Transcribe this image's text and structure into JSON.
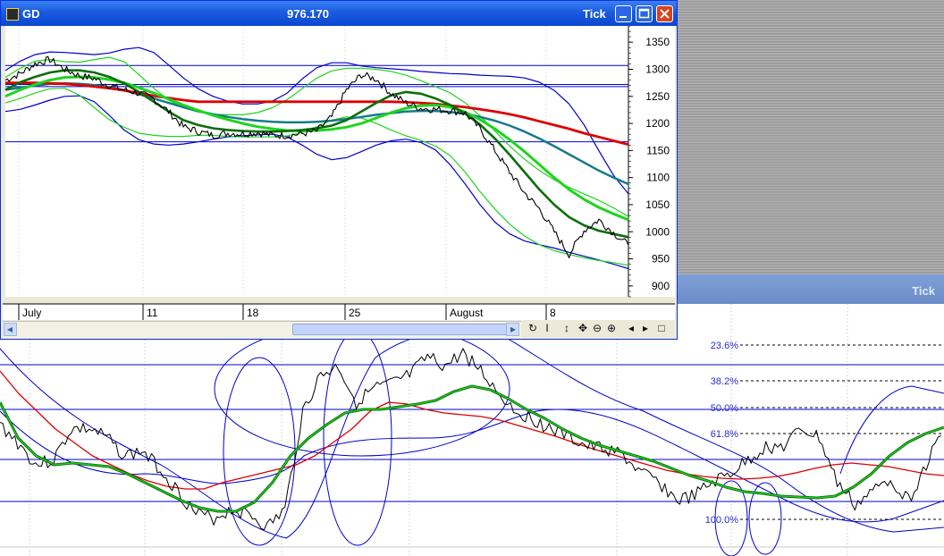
{
  "window": {
    "title": "GD",
    "value": "976.170",
    "mode": "Tick",
    "minimize_icon": "minimize-icon",
    "maximize_icon": "maximize-icon",
    "close_icon": "close-icon"
  },
  "background_window": {
    "mode": "Tick"
  },
  "toolbar": {
    "scroll_left": "◂",
    "scroll_right": "▸",
    "refresh": "↻",
    "cursor": "I",
    "arrange": "↕",
    "pan": "✥",
    "zoom_out": "⊖",
    "zoom_in": "⊕",
    "prev": "◂",
    "next": "▸",
    "restore": "□"
  },
  "colors": {
    "price": "#000000",
    "envelope_blue": "#0000cc",
    "ma_red": "#dd0000",
    "ma_dark_green": "#0a6e0a",
    "ma_green": "#1fd41f",
    "band_light_green": "#1fd41f",
    "ma_teal": "#177a8a",
    "level_line": "#0000cc"
  },
  "chart_data": [
    {
      "type": "line",
      "y_ticks": [
        900,
        950,
        1000,
        1050,
        1100,
        1150,
        1200,
        1250,
        1300,
        1350
      ],
      "ylim": [
        880,
        1380
      ],
      "x_tick_labels": [
        "July",
        "11",
        "18",
        "25",
        "August",
        "8"
      ],
      "horizontal_levels": [
        1307,
        1272,
        1268,
        1166
      ],
      "series": [
        {
          "key": "price",
          "values": [
            1280,
            1292,
            1310,
            1318,
            1300,
            1288,
            1283,
            1270,
            1262,
            1256,
            1245,
            1222,
            1194,
            1185,
            1178,
            1182,
            1181,
            1183,
            1178,
            1178,
            1181,
            1186,
            1212,
            1262,
            1290,
            1282,
            1255,
            1238,
            1228,
            1226,
            1224,
            1219,
            1190,
            1150,
            1110,
            1072,
            1042,
            1000,
            958,
            1002,
            1022,
            998,
            975
          ]
        },
        {
          "key": "ma_red",
          "values": [
            1275,
            1275,
            1275,
            1274,
            1273,
            1271,
            1268,
            1265,
            1261,
            1256,
            1251,
            1247,
            1243,
            1240,
            1240,
            1240,
            1240,
            1240,
            1240,
            1240,
            1240,
            1240,
            1240,
            1240,
            1240,
            1240,
            1240,
            1239,
            1238,
            1236,
            1233,
            1230,
            1226,
            1222,
            1217,
            1211,
            1204,
            1197,
            1190,
            1182,
            1175,
            1168,
            1161
          ]
        },
        {
          "key": "ma_dark_green",
          "values": [
            1262,
            1276,
            1286,
            1294,
            1298,
            1298,
            1294,
            1286,
            1274,
            1258,
            1240,
            1222,
            1206,
            1197,
            1191,
            1188,
            1186,
            1185,
            1185,
            1186,
            1188,
            1191,
            1196,
            1206,
            1222,
            1238,
            1252,
            1258,
            1255,
            1246,
            1234,
            1218,
            1198,
            1172,
            1142,
            1110,
            1078,
            1050,
            1027,
            1012,
            1002,
            996,
            990
          ]
        },
        {
          "key": "ma_green",
          "values": [
            1250,
            1262,
            1272,
            1280,
            1285,
            1286,
            1285,
            1281,
            1275,
            1266,
            1256,
            1245,
            1234,
            1224,
            1215,
            1207,
            1200,
            1194,
            1190,
            1187,
            1186,
            1187,
            1189,
            1193,
            1200,
            1210,
            1220,
            1228,
            1233,
            1234,
            1230,
            1221,
            1207,
            1190,
            1170,
            1148,
            1124,
            1100,
            1078,
            1060,
            1045,
            1033,
            1022
          ]
        },
        {
          "key": "ma_teal",
          "values": [
            1262,
            1266,
            1270,
            1273,
            1274,
            1273,
            1271,
            1267,
            1261,
            1254,
            1246,
            1238,
            1230,
            1223,
            1217,
            1212,
            1208,
            1205,
            1203,
            1202,
            1202,
            1203,
            1205,
            1208,
            1212,
            1216,
            1219,
            1222,
            1223,
            1223,
            1221,
            1218,
            1212,
            1205,
            1196,
            1185,
            1172,
            1158,
            1143,
            1128,
            1113,
            1100,
            1088
          ]
        },
        {
          "key": "env_upper",
          "values": [
            1298,
            1315,
            1327,
            1332,
            1331,
            1329,
            1327,
            1330,
            1337,
            1340,
            1331,
            1308,
            1284,
            1264,
            1250,
            1241,
            1236,
            1236,
            1241,
            1256,
            1282,
            1303,
            1312,
            1312,
            1306,
            1303,
            1301,
            1299,
            1296,
            1294,
            1292,
            1291,
            1289,
            1288,
            1287,
            1284,
            1276,
            1261,
            1236,
            1198,
            1150,
            1104,
            1070
          ]
        },
        {
          "key": "env_lower",
          "values": [
            1222,
            1226,
            1234,
            1243,
            1250,
            1251,
            1240,
            1215,
            1188,
            1170,
            1162,
            1160,
            1162,
            1166,
            1171,
            1175,
            1177,
            1179,
            1180,
            1175,
            1160,
            1143,
            1133,
            1137,
            1148,
            1160,
            1168,
            1171,
            1165,
            1151,
            1123,
            1088,
            1050,
            1018,
            996,
            983,
            976,
            970,
            962,
            955,
            948,
            940,
            932
          ]
        },
        {
          "key": "band_upper",
          "values": [
            1285,
            1302,
            1315,
            1318,
            1314,
            1313,
            1318,
            1322,
            1314,
            1290,
            1265,
            1243,
            1229,
            1221,
            1217,
            1216,
            1216,
            1220,
            1229,
            1244,
            1264,
            1284,
            1297,
            1302,
            1302,
            1300,
            1296,
            1289,
            1279,
            1268,
            1256,
            1238,
            1214,
            1186,
            1158,
            1134,
            1113,
            1096,
            1082,
            1070,
            1058,
            1044,
            1028
          ]
        },
        {
          "key": "band_lower",
          "values": [
            1238,
            1246,
            1256,
            1264,
            1265,
            1252,
            1229,
            1207,
            1193,
            1182,
            1178,
            1176,
            1176,
            1178,
            1178,
            1176,
            1175,
            1175,
            1175,
            1177,
            1183,
            1194,
            1206,
            1212,
            1210,
            1200,
            1188,
            1177,
            1169,
            1158,
            1140,
            1110,
            1074,
            1042,
            1014,
            992,
            976,
            965,
            958,
            952,
            947,
            943,
            938
          ]
        }
      ]
    },
    {
      "type": "line",
      "fib_levels": [
        {
          "label": "23.6%",
          "value": 23.6
        },
        {
          "label": "38.2%",
          "value": 38.2
        },
        {
          "label": "50.0%",
          "value": 50.0
        },
        {
          "label": "61.8%",
          "value": 61.8
        },
        {
          "label": "100.0%",
          "value": 100.0
        }
      ],
      "series": [
        {
          "key": "price",
          "values": [
            135,
            155,
            180,
            175,
            140,
            140,
            150,
            170,
            165,
            185,
            210,
            235,
            240,
            230,
            235,
            250,
            230,
            120,
            80,
            70,
            110,
            95,
            90,
            80,
            60,
            70,
            55,
            75,
            100,
            120,
            130,
            140,
            150,
            160,
            162,
            170,
            190,
            200,
            220,
            215,
            200,
            190,
            175,
            160,
            160,
            140,
            150,
            200,
            225,
            210,
            195,
            220,
            180,
            140
          ]
        },
        {
          "label": "",
          "key": "ma_green",
          "values": [
            110,
            150,
            170,
            180,
            178,
            180,
            182,
            190,
            200,
            210,
            220,
            228,
            232,
            232,
            222,
            200,
            170,
            150,
            135,
            122,
            118,
            118,
            115,
            112,
            108,
            98,
            92,
            96,
            106,
            118,
            128,
            140,
            150,
            158,
            164,
            170,
            176,
            184,
            192,
            198,
            205,
            210,
            212,
            215,
            216,
            217,
            215,
            205,
            190,
            170,
            155,
            145,
            138
          ]
        },
        {
          "key": "ma_red",
          "values": [
            75,
            100,
            120,
            140,
            155,
            170,
            180,
            190,
            198,
            204,
            207,
            207,
            200,
            195,
            190,
            185,
            180,
            170,
            155,
            140,
            120,
            110,
            112,
            118,
            122,
            124,
            126,
            130,
            136,
            142,
            148,
            155,
            162,
            168,
            174,
            180,
            186,
            190,
            193,
            195,
            196,
            195,
            193,
            189,
            184,
            180,
            178,
            180,
            182,
            186,
            190,
            192
          ]
        }
      ]
    }
  ]
}
